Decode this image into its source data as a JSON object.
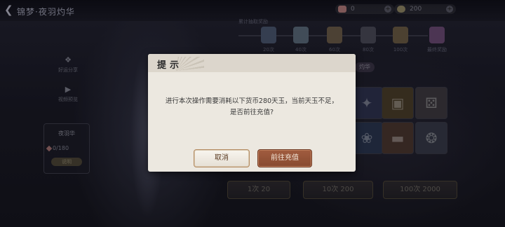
{
  "header": {
    "title": "锦梦·夜羽灼华",
    "currency_a": {
      "value": "0",
      "icon": "ticket-icon",
      "color": "#c78a8a"
    },
    "currency_b": {
      "value": "200",
      "icon": "jade-coin-icon",
      "color": "#9a8f6a"
    }
  },
  "progress": {
    "label": "累计抽取奖励",
    "milestones": [
      {
        "label": "20次",
        "color": "#4a5670"
      },
      {
        "label": "40次",
        "color": "#5a6a7a"
      },
      {
        "label": "60次",
        "color": "#6a5a48"
      },
      {
        "label": "80次",
        "color": "#4a4a58"
      },
      {
        "label": "100次",
        "color": "#6a5a44"
      },
      {
        "label": "最终奖励",
        "color": "#6a4a74"
      }
    ]
  },
  "sidebar": {
    "items": [
      {
        "label": "好运分享",
        "icon": "clover-icon"
      },
      {
        "label": "视频预览",
        "icon": "play-icon"
      }
    ],
    "card": {
      "title": "夜羽华",
      "count": "0/180",
      "tag": "说明"
    }
  },
  "pool": {
    "label": "灼华",
    "items": [
      {
        "icon": "wing-icon",
        "color": "#2f3350"
      },
      {
        "icon": "chest-icon",
        "color": "#4a3d2a"
      },
      {
        "icon": "dice-icon",
        "color": "#3d3a40"
      },
      {
        "icon": "beetle-icon",
        "color": "#2a3550"
      },
      {
        "icon": "scroll-icon",
        "color": "#4a3630"
      },
      {
        "icon": "badge-icon",
        "color": "#363a48"
      }
    ]
  },
  "draw_buttons": [
    {
      "label": "1次",
      "cost": "20"
    },
    {
      "label": "10次",
      "cost": "200"
    },
    {
      "label": "100次",
      "cost": "2000"
    }
  ],
  "dialog": {
    "title": "提示",
    "message_line1": "进行本次操作需要消耗以下货币280天玉，当前天玉不足，",
    "message_line2": "是否前往充值?",
    "cancel_label": "取消",
    "confirm_label": "前往充值",
    "accent_color": "#91533a"
  }
}
